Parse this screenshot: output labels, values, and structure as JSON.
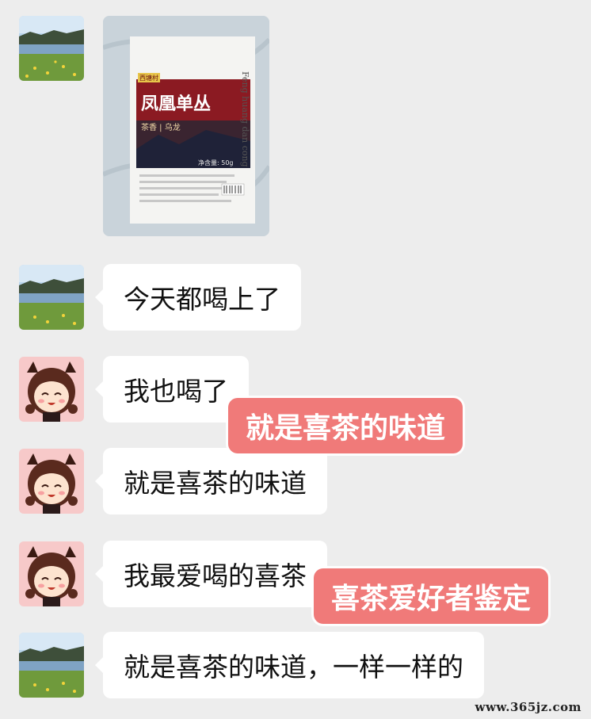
{
  "chat": {
    "messages": [
      {
        "sender": "landscape-user",
        "text": "今天都喝上了"
      },
      {
        "sender": "girl-user",
        "text": "我也喝了"
      },
      {
        "sender": "girl-user",
        "text": "就是喜茶的味道"
      },
      {
        "sender": "girl-user",
        "text": "我最爱喝的喜茶"
      },
      {
        "sender": "landscape-user",
        "text": "就是喜茶的味道，一样一样的"
      }
    ],
    "image_message": {
      "package": {
        "corner_tag": "西塘村",
        "title": "凤凰单丛",
        "subtitle": "茶香 | 乌龙",
        "side_text": "Feng huang dan cong",
        "weight": "净含量: 50g"
      }
    }
  },
  "overlays": {
    "caption_1": "就是喜茶的味道",
    "caption_2": "喜茶爱好者鉴定"
  },
  "watermark": "www.365jz.com"
}
